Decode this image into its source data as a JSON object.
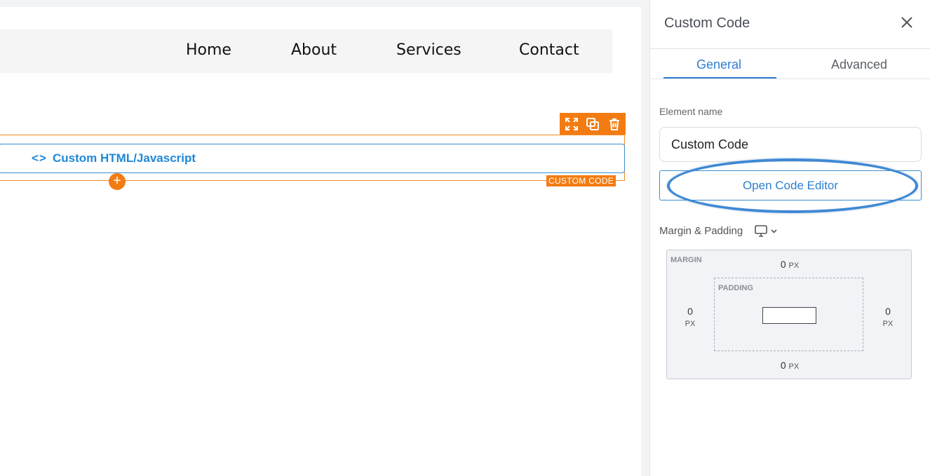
{
  "nav": {
    "items": [
      "Home",
      "About",
      "Services",
      "Contact"
    ]
  },
  "element": {
    "icon": "code-icon",
    "label": "Custom HTML/Javascript",
    "type_badge": "CUSTOM CODE",
    "toolbar_icons": [
      "expand-icon",
      "duplicate-icon",
      "trash-icon"
    ],
    "add_symbol": "+"
  },
  "panel": {
    "title": "Custom Code",
    "tabs": [
      "General",
      "Advanced"
    ],
    "active_tab": "General",
    "element_name_label": "Element name",
    "element_name_value": "Custom Code",
    "open_editor_label": "Open Code Editor",
    "margin_padding_label": "Margin & Padding",
    "box_model": {
      "margin_caption": "MARGIN",
      "padding_caption": "PADDING",
      "margin_top": "0",
      "margin_bottom": "0",
      "margin_left": "0",
      "margin_right": "0",
      "unit": "PX"
    }
  },
  "colors": {
    "accent": "#2f7fd0",
    "element_orange": "#f37c12",
    "highlight": "#3f88d4"
  }
}
